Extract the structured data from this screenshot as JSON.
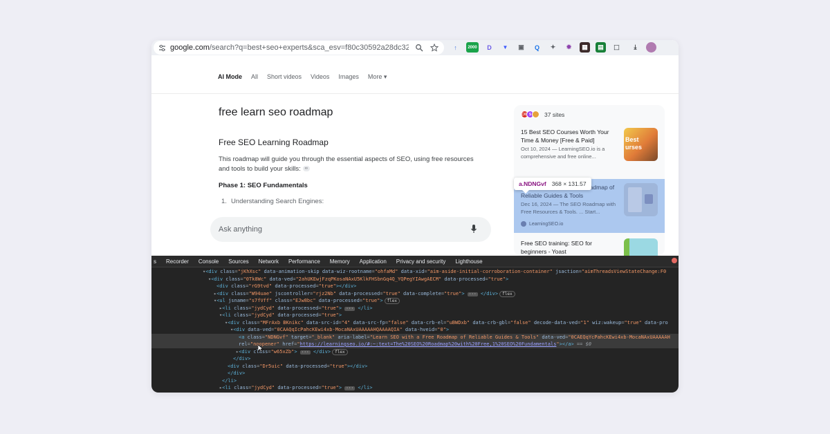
{
  "browser": {
    "url_host": "google.com",
    "url_rest": "/search?q=best+seo+experts&sca_esv=f80c30592a28dc32&sxsrf...",
    "icons": [
      "tune-icon",
      "zoom-icon",
      "star-icon"
    ],
    "extensions": [
      "rocket-ext-icon",
      "grammar-ext-icon",
      "d-ext-icon",
      "v-ext-icon",
      "camera-ext-icon",
      "q-ext-icon",
      "tag-ext-icon",
      "gear-ext-icon",
      "grid-ext-icon",
      "sheet-ext-icon",
      "puzzle-icon",
      "download-icon",
      "profile-avatar"
    ],
    "extension_badge": "2000"
  },
  "search": {
    "tabs": [
      "AI Mode",
      "All",
      "Short videos",
      "Videos",
      "Images",
      "More ▾"
    ],
    "query": "free learn seo roadmap",
    "answer_title": "Free SEO Learning Roadmap",
    "answer_body": "This roadmap will guide you through the essential aspects of SEO, using free resources and tools to build your skills:",
    "phase": "Phase 1: SEO Fundamentals",
    "step_number": "1.",
    "step_text": "Understanding Search Engines:",
    "ask_placeholder": "Ask anything"
  },
  "sources": {
    "count_label": "37 sites",
    "cards": [
      {
        "title": "15 Best SEO Courses Worth Your Time & Money [Free & Paid]",
        "meta": "Oct 10, 2024 — LearningSEO.io is a comprehensive and free online...",
        "thumb_text": "Best urses"
      },
      {
        "title": "Learn SEO with a Free Roadmap of Reliable Guides & Tools",
        "meta": "Dec 16, 2024 — The SEO Roadmap with Free Resources & Tools. ... Start...",
        "site": "LearningSEO.io"
      },
      {
        "title": "Free SEO training: SEO for beginners - Yoast"
      }
    ],
    "tooltip_selector": "a.NDNGvf",
    "tooltip_size": "368 × 131.57"
  },
  "devtools": {
    "tabs": [
      "s",
      "Recorder",
      "Console",
      "Sources",
      "Network",
      "Performance",
      "Memory",
      "Application",
      "Privacy and security",
      "Lighthouse"
    ]
  },
  "colors": {
    "page_bg": "#eeeef5",
    "devtools_bg": "#242424",
    "highlight": "#6ea0e6"
  }
}
